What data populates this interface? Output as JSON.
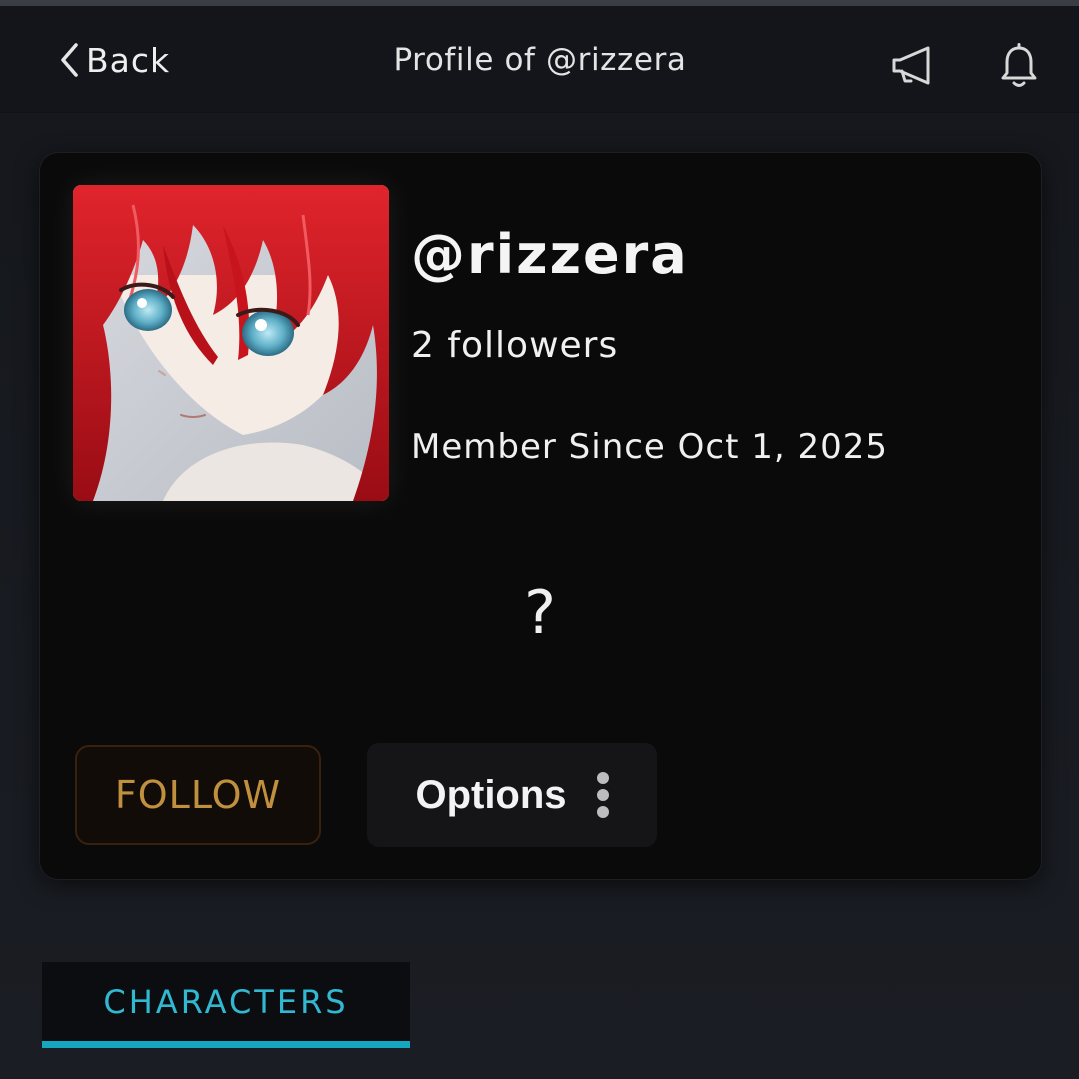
{
  "header": {
    "back_label": "Back",
    "title": "Profile of @rizzera",
    "icons": [
      "chevron-left-icon",
      "megaphone-icon",
      "bell-icon"
    ]
  },
  "profile": {
    "username": "@rizzera",
    "followers": "2 followers",
    "member_since": "Member Since Oct 1, 2025",
    "bio": "?",
    "avatar": "anime-character-avatar"
  },
  "actions": {
    "follow_label": "FOLLOW",
    "options_label": "Options"
  },
  "tabs": [
    {
      "label": "CHARACTERS",
      "active": true
    }
  ],
  "colors": {
    "background": "#15171c",
    "card": "#0a0a0b",
    "follow_text": "#c0903e",
    "tab_accent": "#17a6c2"
  }
}
